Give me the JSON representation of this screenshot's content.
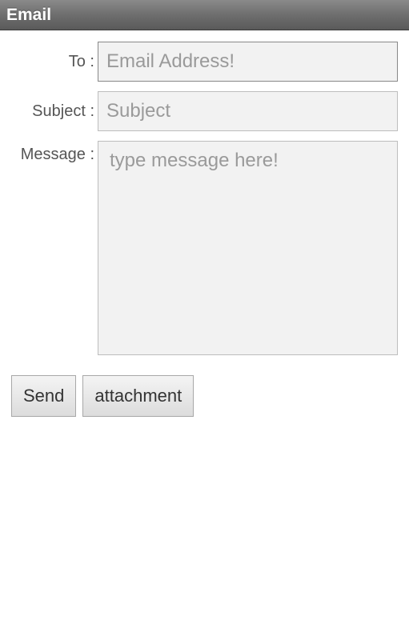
{
  "titlebar": {
    "title": "Email"
  },
  "form": {
    "to_label": "To :",
    "to_placeholder": "Email Address!",
    "to_value": "",
    "subject_label": "Subject :",
    "subject_placeholder": "Subject",
    "subject_value": "",
    "message_label": "Message :",
    "message_placeholder": "type message here!",
    "message_value": ""
  },
  "buttons": {
    "send_label": "Send",
    "attachment_label": "attachment"
  }
}
